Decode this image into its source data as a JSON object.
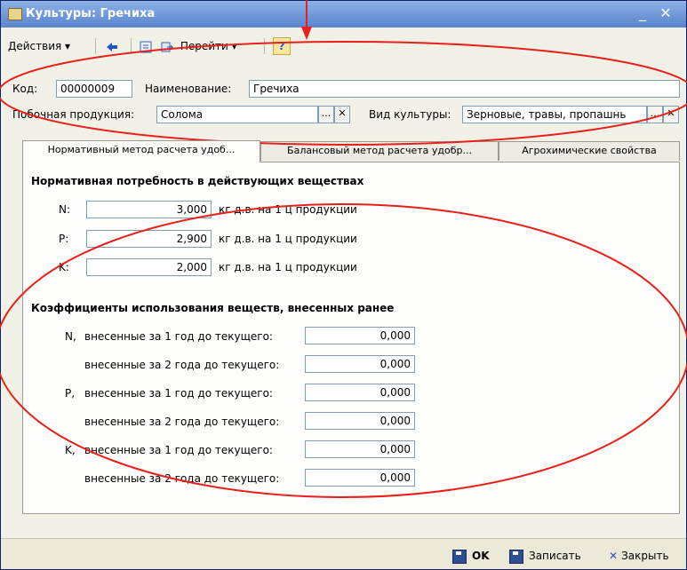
{
  "window": {
    "title": "Культуры: Гречиха",
    "minimize": "_",
    "close": "✕"
  },
  "toolbar": {
    "actions": "Действия",
    "goto": "Перейти",
    "help": "?"
  },
  "header": {
    "code_label": "Код:",
    "code_value": "00000009",
    "name_label": "Наименование:",
    "name_value": "Гречиха",
    "byproduct_label": "Побочная продукция:",
    "byproduct_value": "Солома",
    "culture_type_label": "Вид культуры:",
    "culture_type_value": "Зерновые, травы, пропашнь",
    "select_btn": "...",
    "clear_btn": "✕"
  },
  "tabs": [
    "Нормативный метод расчета удоб...",
    "Балансовый метод расчета удобр...",
    "Агрохимические свойства"
  ],
  "norm": {
    "title": "Нормативная потребность в действующих веществах",
    "unit": "кг д.в. на 1 ц продукции",
    "rows": [
      {
        "label": "N:",
        "value": "3,000"
      },
      {
        "label": "P:",
        "value": "2,900"
      },
      {
        "label": "K:",
        "value": "2,000"
      }
    ]
  },
  "coef": {
    "title": "Коэффициенты использования веществ, внесенных ранее",
    "rows": [
      {
        "element": "N,",
        "label": "внесенные за 1 год до текущего:",
        "value": "0,000"
      },
      {
        "element": "",
        "label": "внесенные за 2 года до текущего:",
        "value": "0,000"
      },
      {
        "element": "P,",
        "label": "внесенные за 1 год до текущего:",
        "value": "0,000"
      },
      {
        "element": "",
        "label": "внесенные за 2 года до текущего:",
        "value": "0,000"
      },
      {
        "element": "K,",
        "label": "внесенные за 1 год до текущего:",
        "value": "0,000"
      },
      {
        "element": "",
        "label": "внесенные за 2 года до текущего:",
        "value": "0,000"
      }
    ]
  },
  "footer": {
    "ok": "OK",
    "save": "Записать",
    "close": "Закрыть"
  },
  "colors": {
    "annotation": "#E8201A",
    "title_bar": "#6D96D8",
    "frame_border": "#0A246A"
  }
}
